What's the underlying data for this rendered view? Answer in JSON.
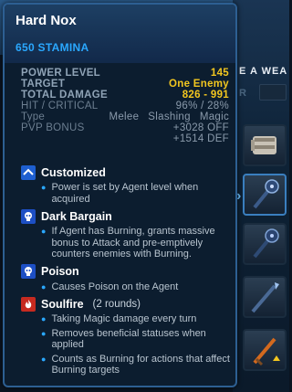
{
  "background": {
    "header_fragment": "E A WEA",
    "sub_fragment": "R"
  },
  "tooltip": {
    "title": "Hard Nox",
    "stamina": "650 STAMINA",
    "stats": [
      {
        "label": "POWER LEVEL",
        "value": "145"
      },
      {
        "label": "TARGET",
        "value": "One Enemy"
      },
      {
        "label": "TOTAL DAMAGE",
        "value": "826 - 991"
      },
      {
        "label": "HIT / CRITICAL",
        "value": "96% / 28%"
      }
    ],
    "type_label": "Type",
    "type_values": [
      "Melee",
      "Slashing",
      "Magic"
    ],
    "pvp_label": "PVP BONUS",
    "pvp_attack": "+3028 OFF",
    "pvp_defense": "+1514 DEF",
    "abilities": [
      {
        "name": "Customized",
        "icon": "level-icon",
        "rounds": "",
        "bullets": [
          "Power is set by Agent level when acquired"
        ]
      },
      {
        "name": "Dark Bargain",
        "icon": "skull-icon",
        "rounds": "",
        "bullets": [
          "If Agent has Burning, grants massive bonus to Attack and pre-emptively counters enemies with Burning."
        ]
      },
      {
        "name": "Poison",
        "icon": "skull-icon",
        "rounds": "",
        "bullets": [
          "Causes Poison on the Agent"
        ]
      },
      {
        "name": "Soulfire",
        "icon": "soulfire-icon",
        "rounds": "(2 rounds)",
        "bullets": [
          "Taking Magic damage every turn",
          "Removes beneficial statuses when applied",
          "Counts as Burning for actions that affect Burning targets"
        ]
      }
    ]
  },
  "colors": {
    "accent_blue": "#2aa8ff",
    "stat_value_gold": "#f2c61f",
    "soulfire_red": "#c62a20"
  }
}
